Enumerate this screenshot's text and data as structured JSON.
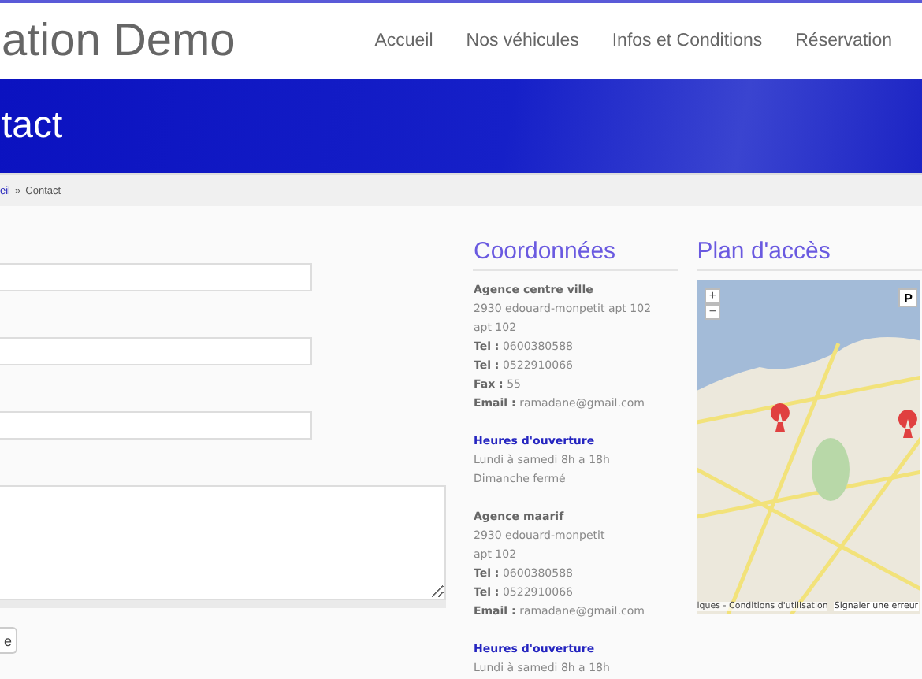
{
  "header": {
    "title": "ation Demo",
    "nav": [
      {
        "label": "Accueil"
      },
      {
        "label": "Nos véhicules"
      },
      {
        "label": "Infos et Conditions"
      },
      {
        "label": "Réservation"
      }
    ]
  },
  "banner": {
    "title": "tact"
  },
  "breadcrumb": {
    "link": "eil",
    "separator": "»",
    "current": "Contact"
  },
  "form": {
    "fields": [
      {
        "kind": "input"
      },
      {
        "kind": "input"
      },
      {
        "kind": "input"
      },
      {
        "kind": "textarea"
      }
    ],
    "button": "e"
  },
  "contact": {
    "title": "Coordonnées",
    "agencies": [
      {
        "name": "Agence centre ville",
        "address": [
          "2930 edouard-monpetit apt 102",
          "apt 102"
        ],
        "contacts": [
          {
            "label": "Tel :",
            "value": "0600380588"
          },
          {
            "label": "Tel :",
            "value": "0522910066"
          },
          {
            "label": "Fax :",
            "value": "55"
          },
          {
            "label": "Email :",
            "value": "ramadane@gmail.com"
          }
        ],
        "hours_title": "Heures d'ouverture",
        "hours": [
          "Lundi à samedi 8h a 18h",
          "Dimanche fermé"
        ]
      },
      {
        "name": "Agence maarif",
        "address": [
          "2930 edouard-monpetit",
          "apt 102"
        ],
        "contacts": [
          {
            "label": "Tel :",
            "value": "0600380588"
          },
          {
            "label": "Tel :",
            "value": "0522910066"
          },
          {
            "label": "Email :",
            "value": "ramadane@gmail.com"
          }
        ],
        "hours_title": "Heures d'ouverture",
        "hours": [
          "Lundi à samedi 8h a 18h"
        ]
      }
    ]
  },
  "map": {
    "title": "Plan d'accès",
    "zoom_in": "+",
    "zoom_out": "−",
    "type_button": "P",
    "attribution": "iques - Conditions d'utilisation",
    "report": "Signaler une erreur"
  }
}
